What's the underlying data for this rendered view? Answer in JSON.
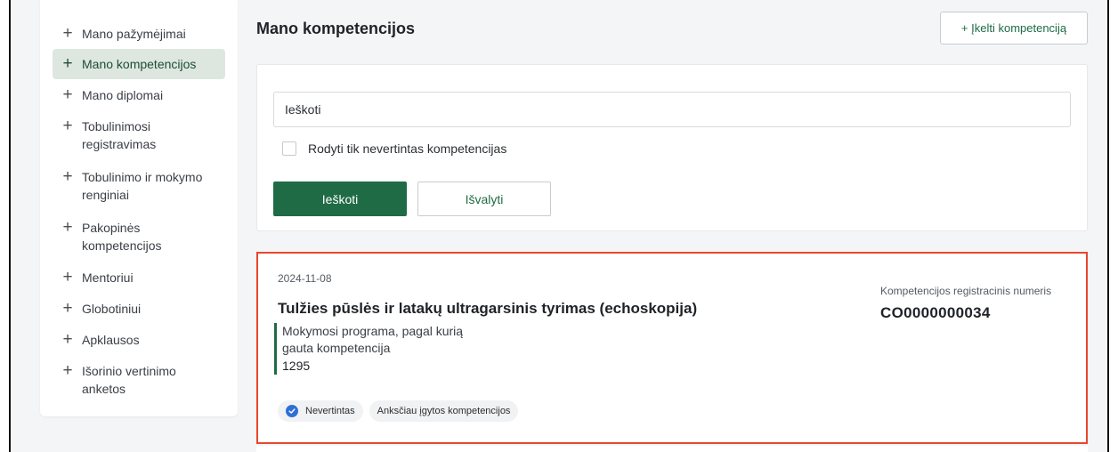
{
  "sidebar": {
    "items": [
      {
        "label": "Mano pažymėjimai",
        "active": false
      },
      {
        "label": "Mano kompetencijos",
        "active": true
      },
      {
        "label": "Mano diplomai",
        "active": false
      },
      {
        "label": "Tobulinimosi registravimas",
        "active": false
      },
      {
        "label": "Tobulinimo ir mokymo renginiai",
        "active": false
      },
      {
        "label": "Pakopinės kompetencijos",
        "active": false
      },
      {
        "label": "Mentoriui",
        "active": false
      },
      {
        "label": "Globotiniui",
        "active": false
      },
      {
        "label": "Apklausos",
        "active": false
      },
      {
        "label": "Išorinio vertinimo anketos",
        "active": false
      }
    ],
    "icon": "plus-icon"
  },
  "header": {
    "title": "Mano kompetencijos",
    "upload_button": "+ Įkelti kompetenciją"
  },
  "filter": {
    "search_placeholder": "Ieškoti",
    "checkbox_label": "Rodyti tik nevertintas kompetencijas",
    "checkbox_checked": false,
    "search_button": "Ieškoti",
    "clear_button": "Išvalyti"
  },
  "result": {
    "date": "2024-11-08",
    "title": "Tulžies pūslės ir latakų ultragarsinis tyrimas (echoskopija)",
    "program_label": "Mokymosi programa, pagal kurią gauta kompetencija",
    "program_value": "1295",
    "reg_label": "Kompetencijos registracinis numeris",
    "reg_number": "CO0000000034",
    "badges": [
      "Nevertintas",
      "Anksčiau įgytos kompetencijos"
    ]
  },
  "colors": {
    "accent": "#1f6b45",
    "highlight_border": "#e8472b",
    "badge_check": "#2f6fd6",
    "sidebar_active_bg": "#dde7e0"
  }
}
